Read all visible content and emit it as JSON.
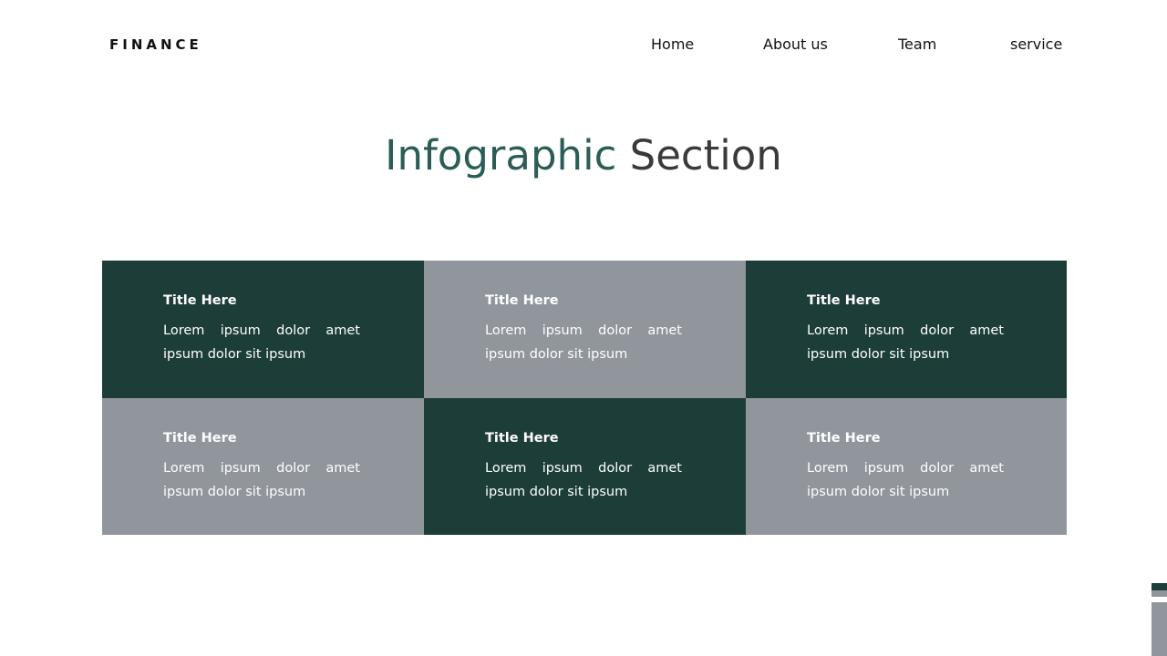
{
  "brand": "FINANCE",
  "nav": {
    "home": "Home",
    "about": "About us",
    "team": "Team",
    "service": "service"
  },
  "heading": {
    "highlight": "Infographic",
    "rest": "Section"
  },
  "cards": [
    {
      "title": "Title Here",
      "text": "Lorem ipsum dolor amet ipsum dolor sit ipsum"
    },
    {
      "title": "Title Here",
      "text": "Lorem ipsum dolor amet ipsum dolor sit ipsum"
    },
    {
      "title": "Title Here",
      "text": "Lorem ipsum dolor amet ipsum dolor sit ipsum"
    },
    {
      "title": "Title Here",
      "text": "Lorem ipsum dolor amet ipsum dolor sit ipsum"
    },
    {
      "title": "Title Here",
      "text": "Lorem ipsum dolor amet ipsum dolor sit ipsum"
    },
    {
      "title": "Title Here",
      "text": "Lorem ipsum dolor amet ipsum dolor sit ipsum"
    }
  ],
  "colors": {
    "dark": "#1d3d39",
    "grey": "#91969d",
    "accent": "#2b5d56"
  }
}
